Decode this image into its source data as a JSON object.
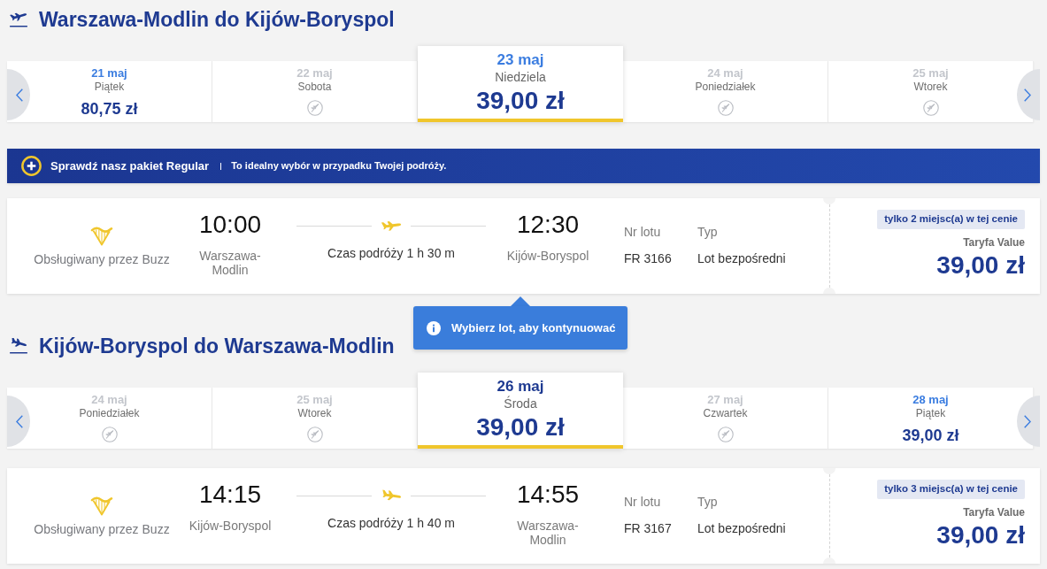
{
  "legs": [
    {
      "kind": "outbound",
      "title": "Warszawa-Modlin do Kijów-Boryspol",
      "dates": [
        {
          "date": "21 maj",
          "weekday": "Piątek",
          "price": "80,75 zł",
          "available": true,
          "selected": false,
          "hovered": false
        },
        {
          "date": "22 maj",
          "weekday": "Sobota",
          "available": false,
          "selected": false,
          "hovered": false
        },
        {
          "date": "23 maj",
          "weekday": "Niedziela",
          "price": "39,00 zł",
          "available": true,
          "selected": true,
          "hovered": false
        },
        {
          "date": "24 maj",
          "weekday": "Poniedziałek",
          "available": false,
          "selected": false,
          "hovered": false
        },
        {
          "date": "25 maj",
          "weekday": "Wtorek",
          "available": false,
          "selected": false,
          "hovered": false
        }
      ],
      "promo_banner": {
        "title": "Sprawdź nasz pakiet Regular",
        "text": "To idealny wybór w przypadku Twojej podróży."
      },
      "flight": {
        "operator": "Obsługiwany przez Buzz",
        "departure_time": "10:00",
        "departure_city": "Warszawa-Modlin",
        "duration": "Czas podróży 1 h 30 m",
        "arrival_time": "12:30",
        "arrival_city": "Kijów-Boryspol",
        "flight_number_label": "Nr lotu",
        "flight_number": "FR 3166",
        "type_label": "Typ",
        "type": "Lot bezpośredni",
        "seats_badge": "tylko 2 miejsc(a) w tej cenie",
        "fare_name": "Taryfa Value",
        "price": "39,00 zł"
      },
      "tooltip": {
        "text": "Wybierz lot, aby kontynuować"
      }
    },
    {
      "kind": "return",
      "title": "Kijów-Boryspol do Warszawa-Modlin",
      "dates": [
        {
          "date": "24 maj",
          "weekday": "Poniedziałek",
          "available": false,
          "selected": false,
          "hovered": false
        },
        {
          "date": "25 maj",
          "weekday": "Wtorek",
          "available": false,
          "selected": false,
          "hovered": false
        },
        {
          "date": "26 maj",
          "weekday": "Środa",
          "price": "39,00 zł",
          "available": true,
          "selected": true,
          "hovered": true
        },
        {
          "date": "27 maj",
          "weekday": "Czwartek",
          "available": false,
          "selected": false,
          "hovered": false
        },
        {
          "date": "28 maj",
          "weekday": "Piątek",
          "price": "39,00 zł",
          "available": true,
          "selected": false,
          "hovered": false
        }
      ],
      "flight": {
        "operator": "Obsługiwany przez Buzz",
        "departure_time": "14:15",
        "departure_city": "Kijów-Boryspol",
        "duration": "Czas podróży 1 h 40 m",
        "arrival_time": "14:55",
        "arrival_city": "Warszawa-Modlin",
        "flight_number_label": "Nr lotu",
        "flight_number": "FR 3167",
        "type_label": "Typ",
        "type": "Lot bezpośredni",
        "seats_badge": "tylko 3 miejsc(a) w tej cenie",
        "fare_name": "Taryfa Value",
        "price": "39,00 zł"
      }
    }
  ]
}
